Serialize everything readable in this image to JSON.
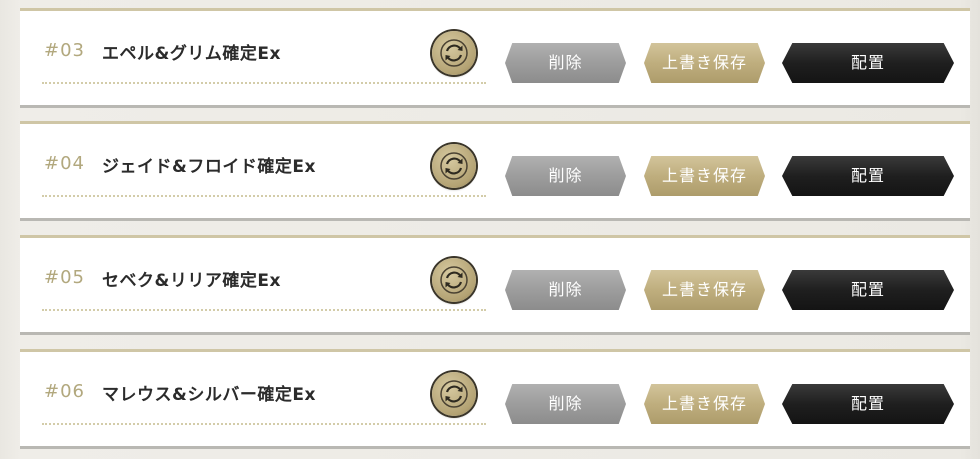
{
  "rows": [
    {
      "number": "#03",
      "name": "エペル&グリム確定Ex",
      "delete_label": "削除",
      "overwrite_label": "上書き保存",
      "place_label": "配置"
    },
    {
      "number": "#04",
      "name": "ジェイド&フロイド確定Ex",
      "delete_label": "削除",
      "overwrite_label": "上書き保存",
      "place_label": "配置"
    },
    {
      "number": "#05",
      "name": "セベク&リリア確定Ex",
      "delete_label": "削除",
      "overwrite_label": "上書き保存",
      "place_label": "配置"
    },
    {
      "number": "#06",
      "name": "マレウス&シルバー確定Ex",
      "delete_label": "削除",
      "overwrite_label": "上書き保存",
      "place_label": "配置"
    }
  ],
  "icons": {
    "sync": "sync-icon"
  },
  "colors": {
    "number_gold": "#b2a87e",
    "overwrite_gold": "#bfae7e",
    "delete_gray": "#9d9d9d",
    "place_black": "#1f1f1f"
  }
}
